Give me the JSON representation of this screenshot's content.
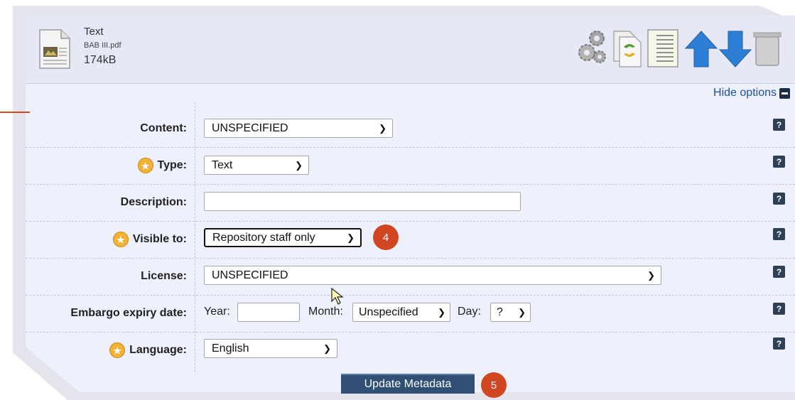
{
  "file": {
    "type_title": "Text",
    "filename": "BAB III.pdf",
    "size": "174kB"
  },
  "toolbar": {
    "icons": [
      "gears-icon",
      "convert-document-icon",
      "text-lines-icon",
      "move-up-arrow-icon",
      "move-down-arrow-icon",
      "trash-icon"
    ]
  },
  "options_toggle": {
    "label": "Hide options"
  },
  "fields": {
    "content": {
      "label": "Content:",
      "value": "UNSPECIFIED"
    },
    "type": {
      "label": "Type:",
      "value": "Text"
    },
    "description": {
      "label": "Description:",
      "value": ""
    },
    "visible_to": {
      "label": "Visible to:",
      "value": "Repository staff only"
    },
    "license": {
      "label": "License:",
      "value": "UNSPECIFIED"
    },
    "embargo": {
      "label": "Embargo expiry date:",
      "year_label": "Year:",
      "year_value": "",
      "month_label": "Month:",
      "month_value": "Unspecified",
      "day_label": "Day:",
      "day_value": "?"
    },
    "language": {
      "label": "Language:",
      "value": "English"
    }
  },
  "help_label": "?",
  "required_marker": "star-icon",
  "update_button": {
    "label": "Update Metadata"
  },
  "steps": {
    "step4": "4",
    "step5": "5"
  },
  "colors": {
    "panel_bg": "#eef0fb",
    "button_bg": "#2f4f74",
    "badge": "#cf4620",
    "link": "#1c4fa0"
  }
}
